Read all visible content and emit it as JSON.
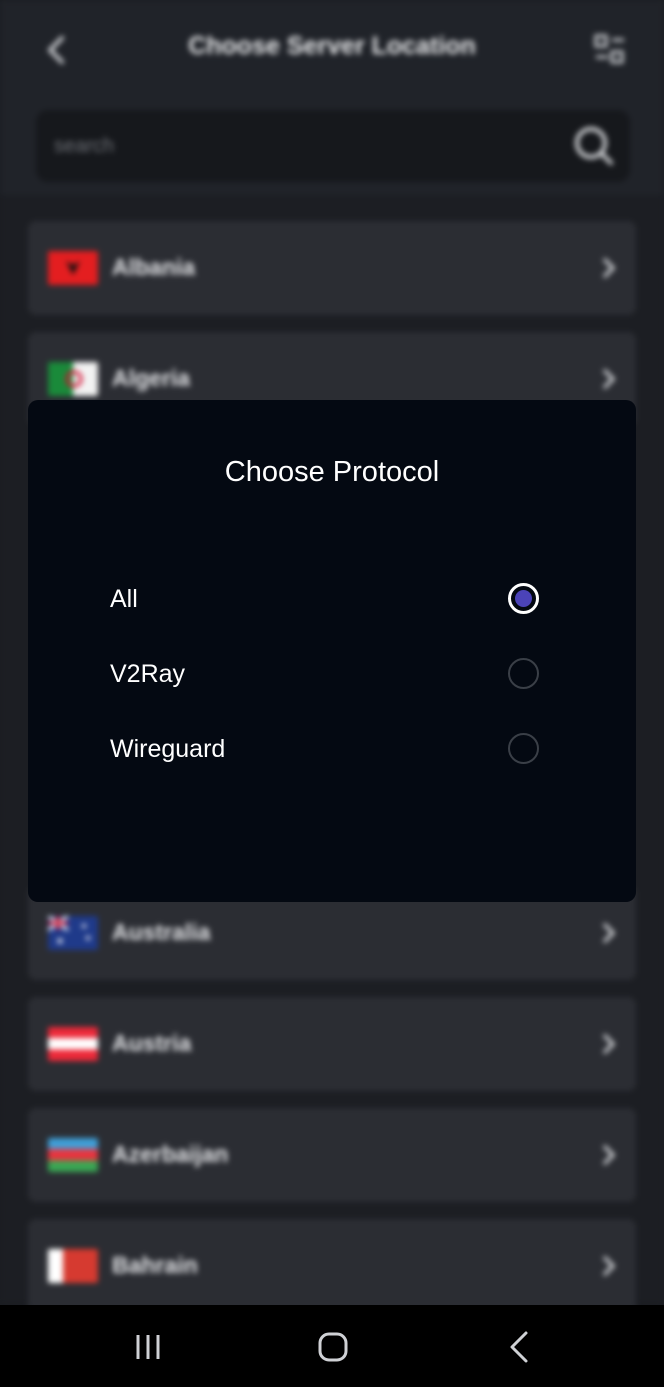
{
  "header": {
    "title": "Choose Server Location",
    "back_icon": "chevron-left-icon",
    "filter_icon": "filter-grid-icon"
  },
  "search": {
    "placeholder": "search",
    "icon": "search-icon"
  },
  "countries": [
    {
      "name": "Albania",
      "flag_icon": "flag-albania-icon"
    },
    {
      "name": "Algeria",
      "flag_icon": "flag-algeria-icon"
    },
    {
      "name": "Australia",
      "flag_icon": "flag-australia-icon"
    },
    {
      "name": "Austria",
      "flag_icon": "flag-austria-icon"
    },
    {
      "name": "Azerbaijan",
      "flag_icon": "flag-azerbaijan-icon"
    },
    {
      "name": "Bahrain",
      "flag_icon": "flag-bahrain-icon"
    }
  ],
  "dialog": {
    "title": "Choose Protocol",
    "options": [
      {
        "label": "All",
        "selected": true
      },
      {
        "label": "V2Ray",
        "selected": false
      },
      {
        "label": "Wireguard",
        "selected": false
      }
    ]
  },
  "navbar": {
    "recents_icon": "recents-icon",
    "home_icon": "home-icon",
    "back_icon": "back-icon"
  },
  "colors": {
    "dialog_bg": "#040912",
    "radio_accent": "#4b43b8",
    "row_bg": "#2b2d33"
  }
}
